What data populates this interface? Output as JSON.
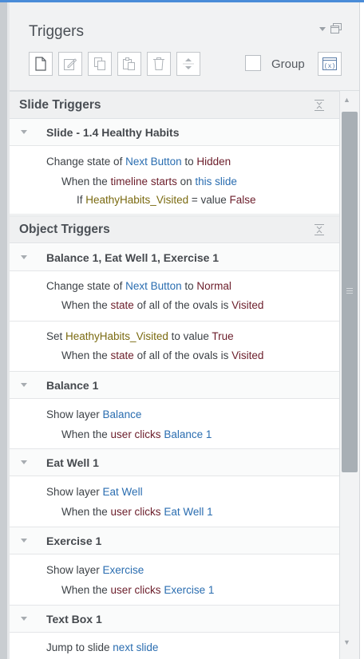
{
  "panel": {
    "title": "Triggers",
    "menu_icon": "dropdown-arrow-icon",
    "restore_icon": "restore-window-icon",
    "group_label": "Group",
    "toolbar_icons": [
      "new-trigger-icon",
      "edit-trigger-icon",
      "copy-icon",
      "paste-icon",
      "delete-icon",
      "move-up-down-icon",
      "variables-icon"
    ]
  },
  "slide_triggers": {
    "header": "Slide Triggers",
    "object": "Slide - 1.4 Healthy Habits",
    "trigger": {
      "p1": "Change state of ",
      "p2": "Next Button",
      "p3": " to ",
      "p4": "Hidden",
      "w1": "When the ",
      "w2": "timeline starts",
      "w3": " on ",
      "w4": "this slide",
      "c1": "If ",
      "c2": "HeathyHabits_Visited",
      "c3": " = value ",
      "c4": "False"
    }
  },
  "object_triggers": {
    "header": "Object Triggers",
    "groups": [
      {
        "name": "Balance 1, Eat Well 1, Exercise 1",
        "t1": {
          "p1": "Change state of ",
          "p2": "Next Button",
          "p3": " to ",
          "p4": "Normal",
          "w1": "When the ",
          "w2": "state",
          "w3": " of all of the ovals is ",
          "w4": "Visited"
        },
        "t2": {
          "p1": "Set ",
          "p2": "HeathyHabits_Visited",
          "p3": " to value ",
          "p4": "True",
          "w1": "When the ",
          "w2": "state",
          "w3": " of all of the ovals is ",
          "w4": "Visited"
        }
      },
      {
        "name": "Balance 1",
        "a1": "Show layer ",
        "a2": "Balance",
        "w1": "When the ",
        "w2": "user clicks",
        "w3": " ",
        "w4": "Balance 1"
      },
      {
        "name": "Eat Well 1",
        "a1": "Show layer ",
        "a2": "Eat Well",
        "w1": "When the ",
        "w2": "user clicks",
        "w3": " ",
        "w4": "Eat Well 1"
      },
      {
        "name": "Exercise 1",
        "a1": "Show layer ",
        "a2": "Exercise",
        "w1": "When the ",
        "w2": "user clicks",
        "w3": " ",
        "w4": "Exercise 1"
      },
      {
        "name": "Text Box 1",
        "a1": "Jump to slide ",
        "a2": "next slide"
      }
    ]
  },
  "colors": {
    "link": "#2a6db0",
    "variable": "#7a6a10",
    "state": "#6b1d2a",
    "accent": "#4a8cd8"
  }
}
